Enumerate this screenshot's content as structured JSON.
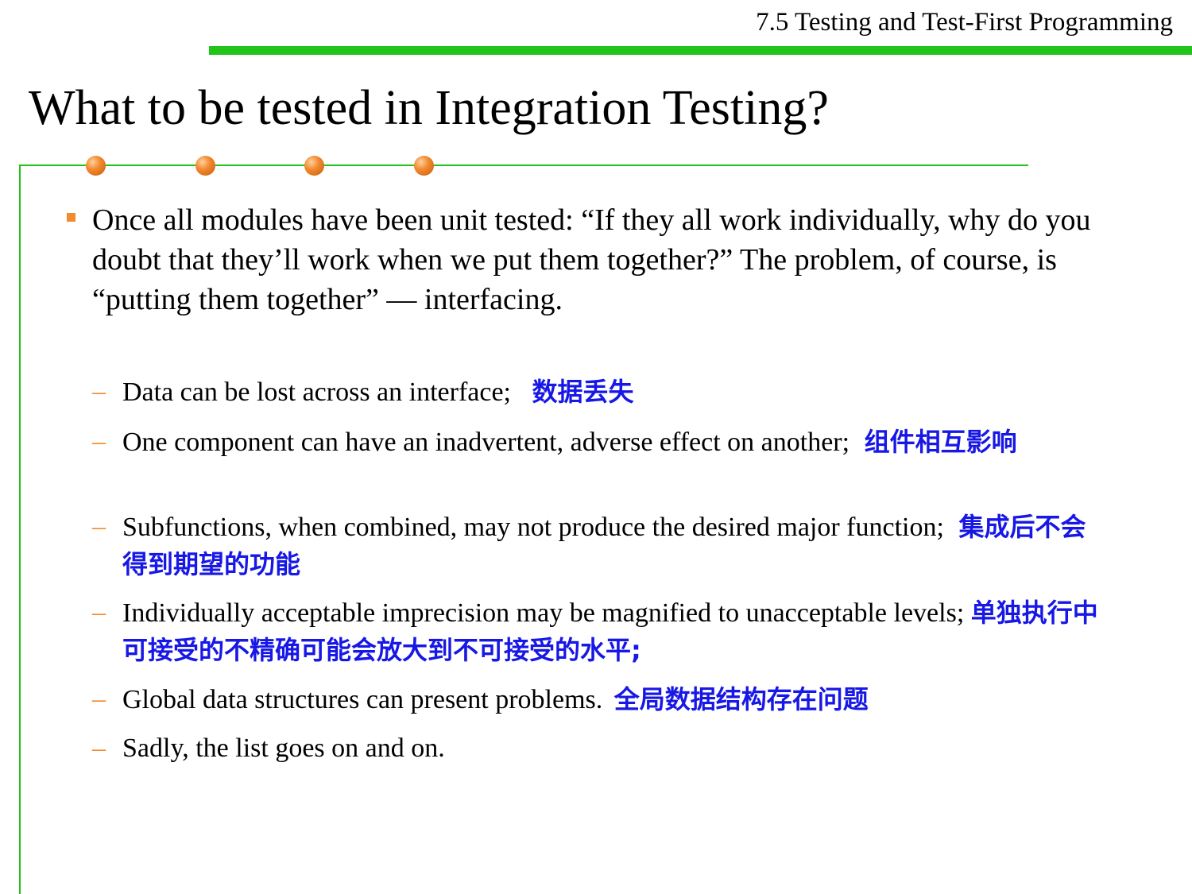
{
  "header": {
    "section_title": "7.5 Testing and Test-First Programming"
  },
  "slide": {
    "title": "What to be tested in Integration Testing?",
    "main_point": "Once all modules have been unit tested: “If they all work individually, why do you doubt that they’ll work when we put them together?” The problem, of course, is “putting them together” — interfacing.",
    "sub_points": [
      {
        "text": "Data can be lost across an interface;",
        "note": "数据丢失"
      },
      {
        "text": "One component can have an inadvertent, adverse effect on another;",
        "note": "组件相互影响"
      },
      {
        "text": "Subfunctions, when combined, may not produce the desired major function;",
        "note": "集成后不会得到期望的功能"
      },
      {
        "text": "Individually acceptable imprecision may be magnified to unacceptable levels;",
        "note": "单独执行中可接受的不精确可能会放大到不可接受的水平;"
      },
      {
        "text": "Global data structures can present problems.",
        "note": "全局数据结构存在问题"
      },
      {
        "text": "Sadly, the list goes on and on.",
        "note": ""
      }
    ]
  },
  "bullet_marker": "–",
  "colors": {
    "accent_green": "#22c41a",
    "bullet_orange": "#f28a2e",
    "annotation_blue": "#1717e6"
  },
  "decorations": {
    "dots": [
      "orange-dot-icon",
      "orange-dot-icon",
      "orange-dot-icon",
      "orange-dot-icon"
    ],
    "main_bullet_icon": "orange-square-bullet-icon"
  }
}
